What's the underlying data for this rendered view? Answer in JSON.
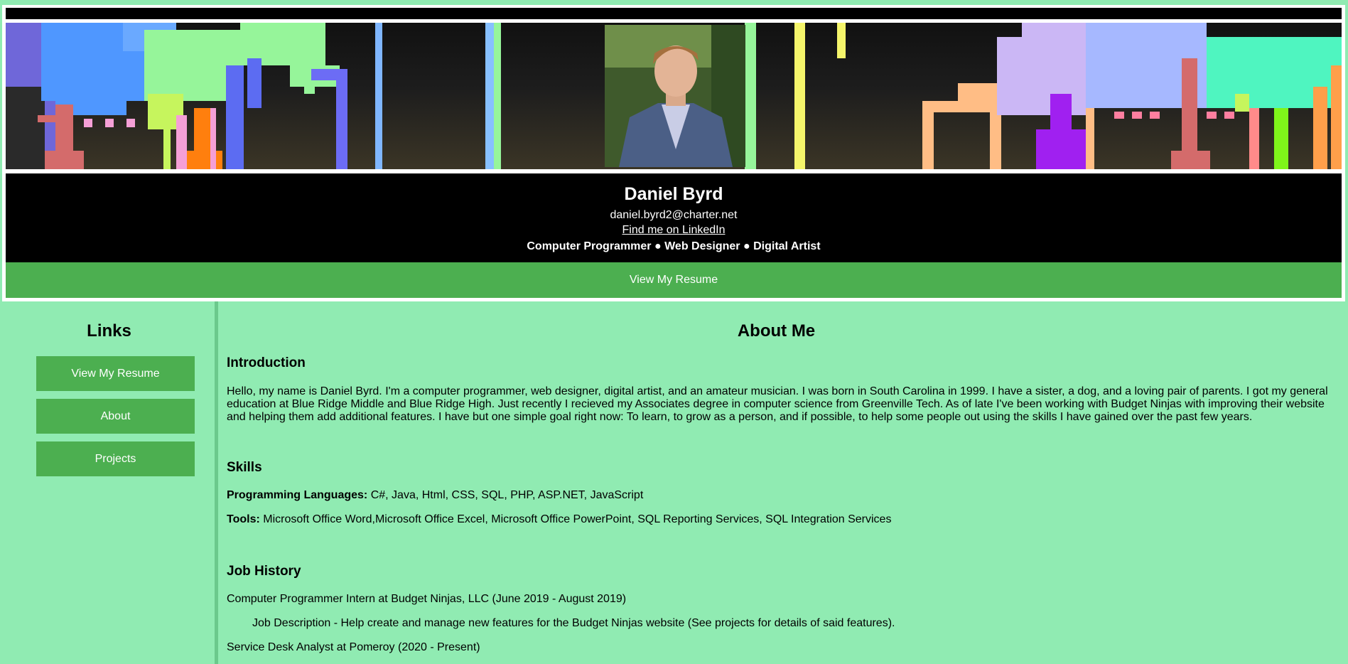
{
  "header": {
    "name": "Daniel Byrd",
    "email": "daniel.byrd2@charter.net",
    "linkedin_label": "Find me on LinkedIn",
    "roles": [
      "Computer Programmer",
      "Web Designer",
      "Digital Artist"
    ],
    "role_separator": "●",
    "resume_button": "View My Resume"
  },
  "sidebar": {
    "title": "Links",
    "buttons": [
      {
        "label": "View My Resume"
      },
      {
        "label": "About"
      },
      {
        "label": "Projects"
      }
    ]
  },
  "main": {
    "title": "About Me",
    "intro": {
      "heading": "Introduction",
      "text": "Hello, my name is Daniel Byrd. I'm a computer programmer, web designer, digital artist, and an amateur musician. I was born in South Carolina in 1999. I have a sister, a dog, and a loving pair of parents. I got my general education at Blue Ridge Middle and Blue Ridge High. Just recently I recieved my Associates degree in computer science from Greenville Tech. As of late I've been working with Budget Ninjas with improving their website and helping them add additional features. I have but one simple goal right now: To learn, to grow as a person, and if possible, to help some people out using the skills I have gained over the past few years."
    },
    "skills": {
      "heading": "Skills",
      "languages_label": "Programming Languages:",
      "languages": "C#, Java, Html, CSS, SQL, PHP, ASP.NET, JavaScript",
      "tools_label": "Tools:",
      "tools": "Microsoft Office Word,Microsoft Office Excel, Microsoft Office PowerPoint, SQL Reporting Services, SQL Integration Services"
    },
    "jobs": {
      "heading": "Job History",
      "items": [
        {
          "title": "Computer Programmer Intern at Budget Ninjas, LLC (June 2019 - August 2019)",
          "description": "Job Description - Help create and manage new features for the Budget Ninjas website (See projects for details of said features)."
        },
        {
          "title": "Service Desk Analyst at Pomeroy (2020 - Present)"
        }
      ]
    }
  },
  "colors": {
    "page_bg": "#90ebb2",
    "accent_green": "#4caf50",
    "header_black": "#000000"
  }
}
